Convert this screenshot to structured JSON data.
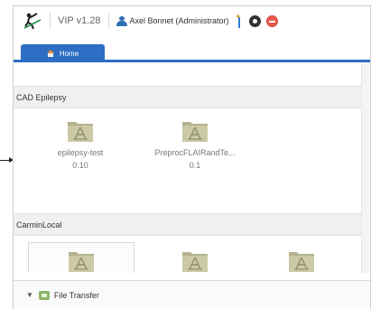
{
  "header": {
    "version": "VIP v1.28",
    "user_name": "Axel Bonnet (Administrator)"
  },
  "tabs": [
    {
      "label": "Home",
      "active": true
    }
  ],
  "sections": [
    {
      "title": "CAD Epilepsy",
      "items": [
        {
          "name": "epilepsy-test",
          "version": "0.10"
        },
        {
          "name": "PreprocFLAIRandTe...",
          "version": "0.1"
        }
      ]
    },
    {
      "title": "CarminLocal",
      "items": [
        {
          "name": "",
          "version": "",
          "selected": true
        },
        {
          "name": "",
          "version": ""
        },
        {
          "name": "",
          "version": ""
        }
      ]
    }
  ],
  "footer": {
    "label": "File Transfer"
  },
  "colors": {
    "accent": "#2d6ec4",
    "folder": "#c9c7a4",
    "section_bg": "#f0f0f0"
  }
}
